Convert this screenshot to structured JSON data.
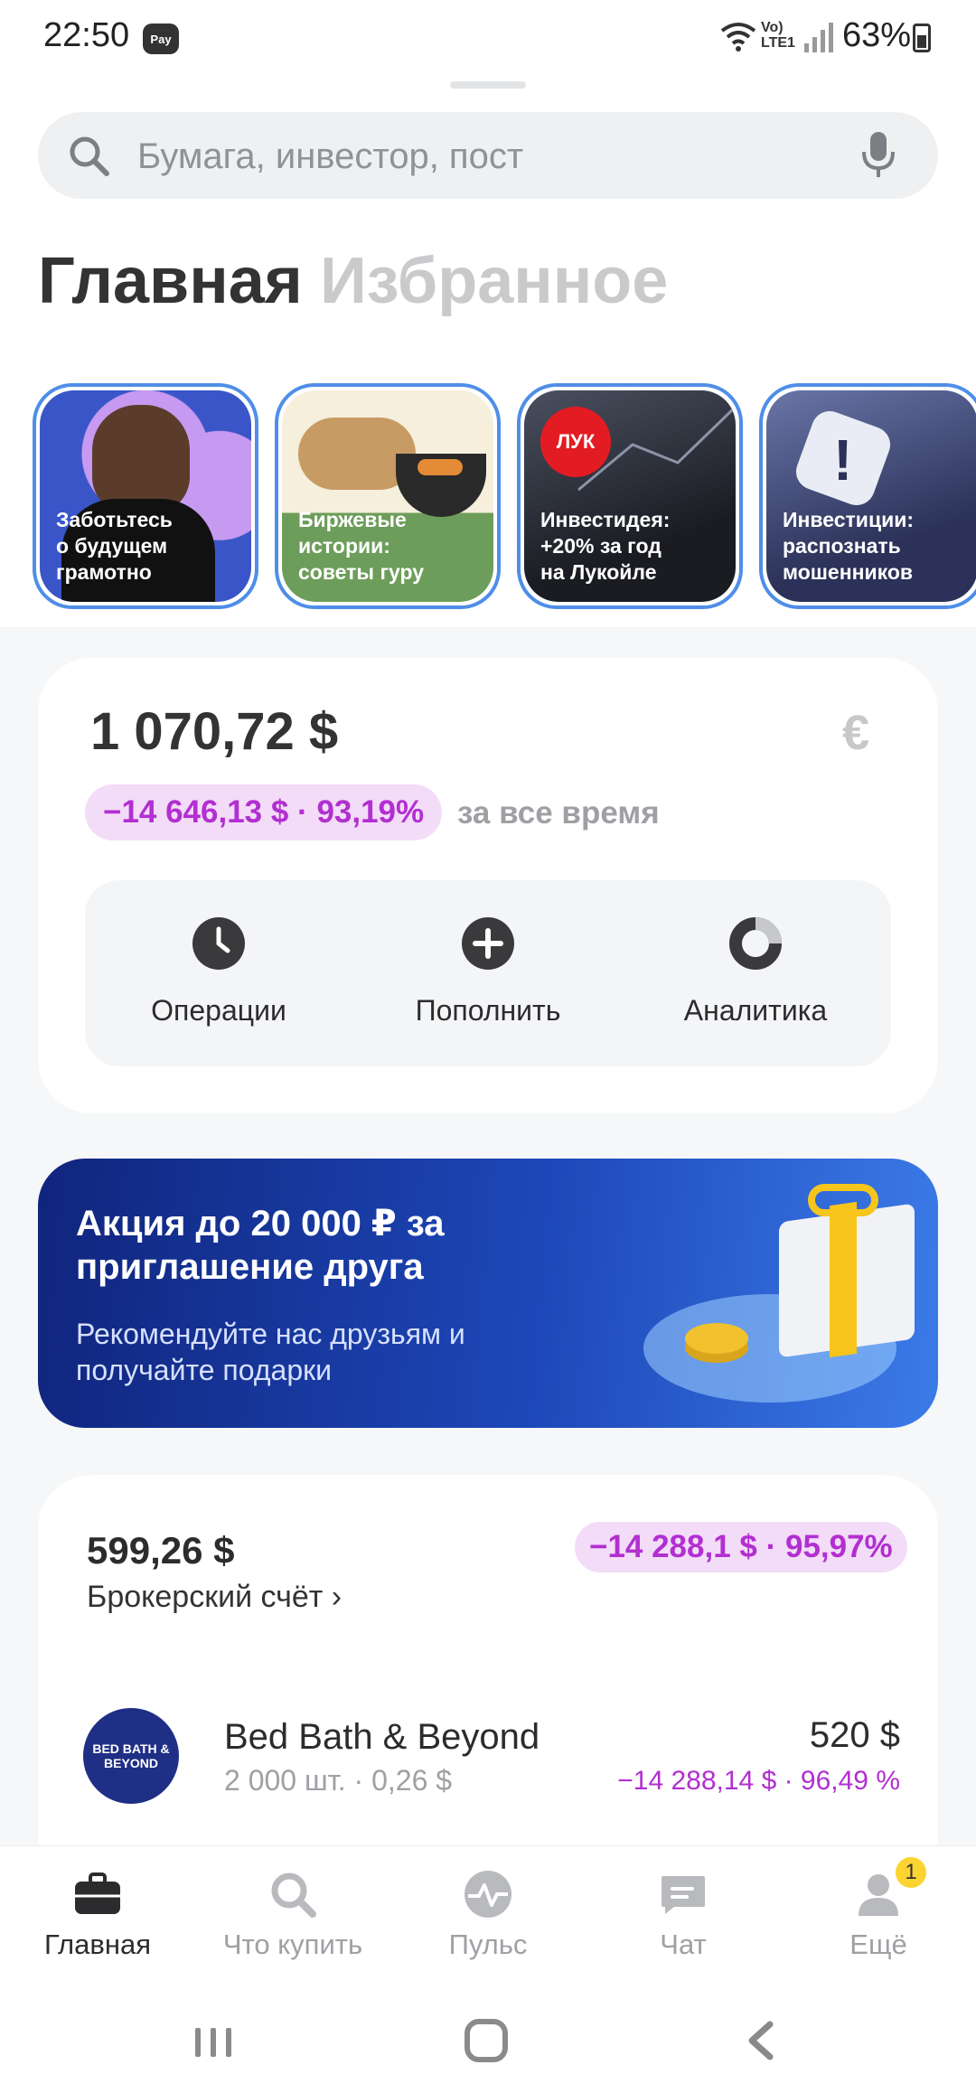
{
  "status_bar": {
    "time": "22:50",
    "pay_badge": "Pay",
    "volte": "Vo)\nLTE1",
    "battery": "63%"
  },
  "search": {
    "placeholder": "Бумага, инвестор, пост"
  },
  "tabs": [
    {
      "label": "Главная",
      "active": true
    },
    {
      "label": "Избранное",
      "active": false
    }
  ],
  "stories": [
    {
      "text": "Заботьтесь\nо будущем\nграмотно"
    },
    {
      "text": "Биржевые\nистории:\nсоветы гуру"
    },
    {
      "text": "Инвестидея:\n+20% за год\nна Лукойле",
      "logo": "ЛУК"
    },
    {
      "text": "Инвестиции:\nраспознать\nмошенников"
    }
  ],
  "portfolio": {
    "total": "1 070,72 $",
    "currency_icon": "€",
    "change": "−14 646,13 $ · 93,19%",
    "period": "за все время",
    "actions": [
      {
        "label": "Операции",
        "icon": "clock-icon"
      },
      {
        "label": "Пополнить",
        "icon": "plus-circle-icon"
      },
      {
        "label": "Аналитика",
        "icon": "donut-chart-icon"
      }
    ]
  },
  "promo": {
    "title": "Акция до 20 000 ₽ за приглашение друга",
    "text": "Рекомендуйте нас друзьям и получайте подарки"
  },
  "broker": {
    "value": "599,26 $",
    "label": "Брокерский счёт ›",
    "change": "−14 288,1 $ · 95,97%",
    "positions": [
      {
        "logo": "BED BATH &\nBEYOND",
        "name": "Bed Bath & Beyond",
        "qty": "2 000 шт. · 0,26 $",
        "value": "520 $",
        "change": "−14 288,14 $ · 96,49 %"
      }
    ]
  },
  "bottom_nav": [
    {
      "label": "Главная",
      "icon": "briefcase-icon",
      "active": true
    },
    {
      "label": "Что купить",
      "icon": "search-icon"
    },
    {
      "label": "Пульс",
      "icon": "pulse-icon"
    },
    {
      "label": "Чат",
      "icon": "chat-icon"
    },
    {
      "label": "Ещё",
      "icon": "profile-icon",
      "badge": "1"
    }
  ],
  "colors": {
    "accent_purple": "#b22fd1",
    "badge_bg": "#f3dcf7",
    "story_border": "#4f8ee8",
    "promo_blue": "#1d47b8"
  }
}
